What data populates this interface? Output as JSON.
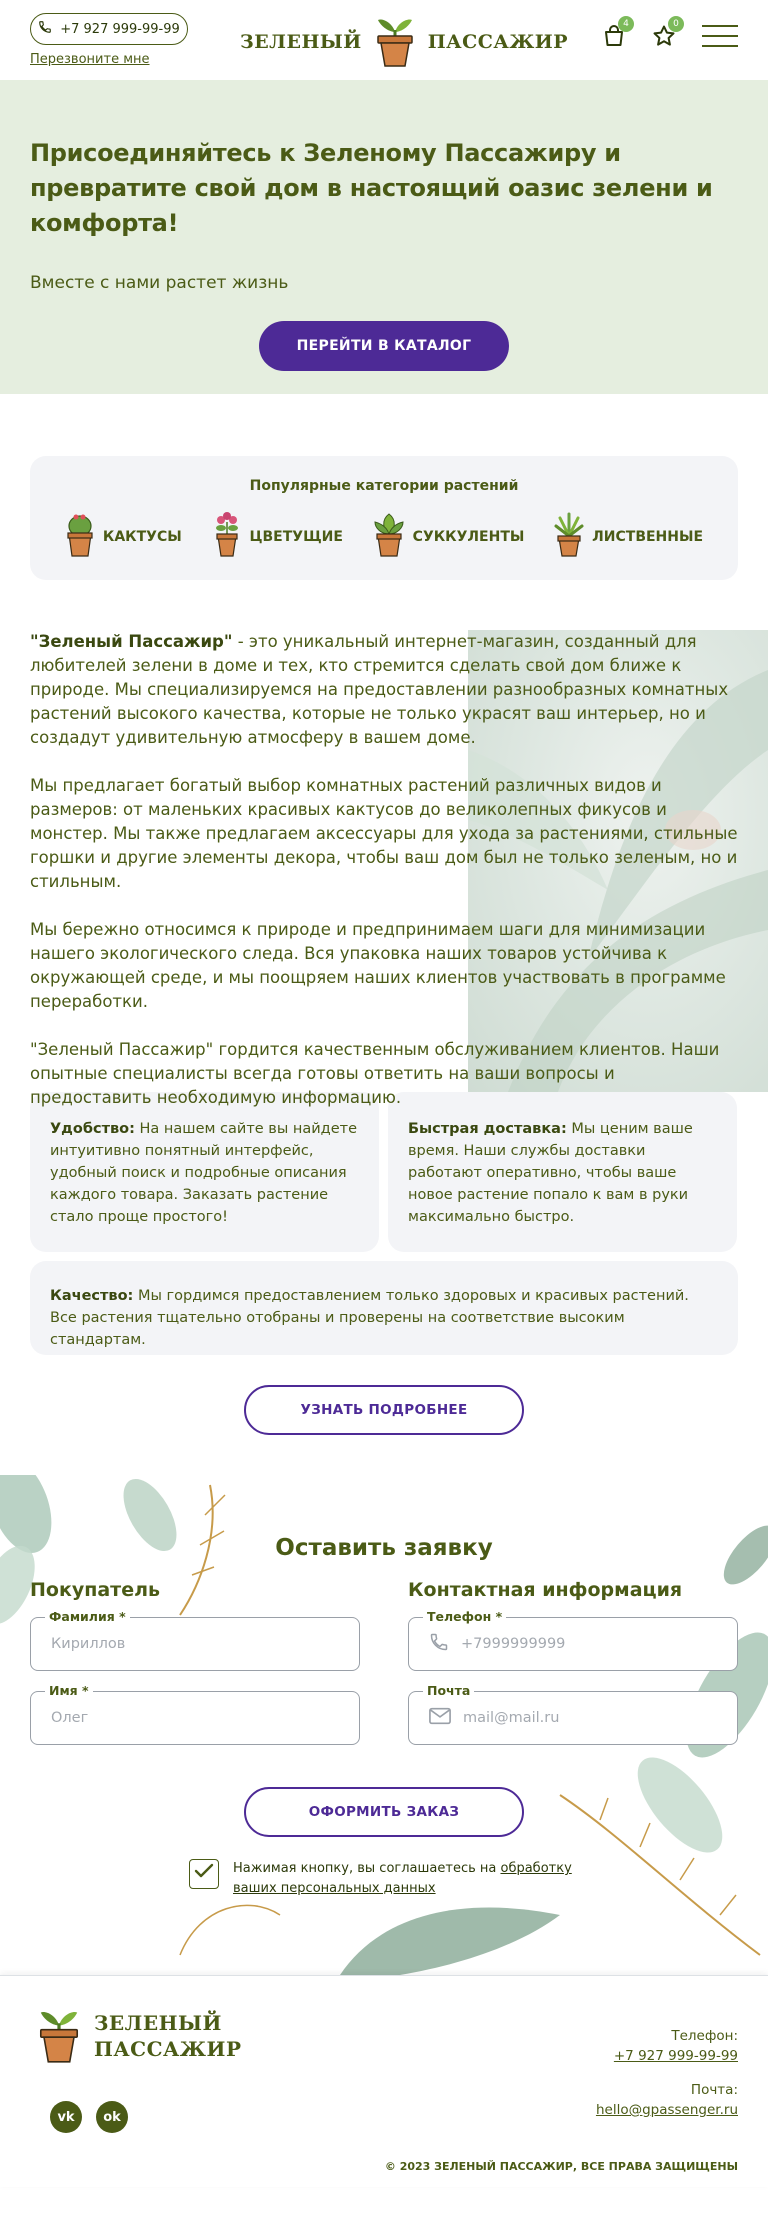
{
  "header": {
    "phone": "+7 927 999-99-99",
    "callback_link": "Перезвоните мне",
    "logo_left": "ЗЕЛЕНЫЙ",
    "logo_right": "ПАССАЖИР",
    "cart_count": "4",
    "favorites_count": "0"
  },
  "hero": {
    "title": "Присоединяйтесь к Зеленому Пассажиру и превратите свой дом в настоящий оазис зелени и комфорта!",
    "subtitle": "Вместе с нами растет жизнь",
    "button": "ПЕРЕЙТИ В КАТАЛОГ"
  },
  "categories": {
    "title": "Популярные категории растений",
    "items": [
      {
        "label": "КАКТУСЫ",
        "icon": "cactus-icon"
      },
      {
        "label": "ЦВЕТУЩИЕ",
        "icon": "flowering-plant-icon"
      },
      {
        "label": "СУККУЛЕНТЫ",
        "icon": "succulent-icon"
      },
      {
        "label": "ЛИСТВЕННЫЕ",
        "icon": "leafy-plant-icon"
      }
    ]
  },
  "about": {
    "p1_strong": "\"Зеленый Пассажир\"",
    "p1": " - это уникальный интернет-магазин, созданный для любителей зелени в доме и тех, кто стремится сделать свой дом ближе к природе. Мы специализируемся на предоставлении разнообразных комнатных растений высокого качества, которые не только украсят ваш интерьер, но и создадут удивительную атмосферу в вашем доме.",
    "p2": "Мы предлагает богатый выбор комнатных растений различных видов и размеров: от маленьких красивых кактусов до великолепных фикусов и монстер. Мы также предлагаем аксессуары для ухода за растениями, стильные горшки и другие элементы декора, чтобы ваш дом был не только зеленым, но и стильным.",
    "p3": "Мы бережно относимся к природе и предпринимаем шаги для минимизации нашего экологического следа. Вся упаковка наших товаров устойчива к окружающей среде, и мы поощряем наших клиентов участвовать в программе переработки.",
    "p4": "\"Зеленый Пассажир\" гордится качественным обслуживанием клиентов. Наши опытные специалисты всегда готовы ответить на ваши вопросы и предоставить необходимую информацию."
  },
  "features": {
    "convenience_title": "Удобство:",
    "convenience_text": " На нашем сайте вы найдете интуитивно понятный интерфейс, удобный поиск и подробные описания каждого товара. Заказать растение стало проще простого!",
    "delivery_title": "Быстрая доставка:",
    "delivery_text": " Мы ценим ваше время. Наши службы доставки работают оперативно, чтобы ваше новое растение попало к вам в руки максимально быстро.",
    "quality_title": "Качество:",
    "quality_text": " Мы гордимся предоставлением только здоровых и красивых растений. Все растения тщательно отобраны и проверены на соответствие высоким стандартам.",
    "more_button": "УЗНАТЬ ПОДРОБНЕЕ"
  },
  "order": {
    "title": "Оставить заявку",
    "buyer_heading": "Покупатель",
    "contact_heading": "Контактная информация",
    "surname_label": "Фамилия *",
    "surname_placeholder": "Кириллов",
    "name_label": "Имя *",
    "name_placeholder": "Олег",
    "phone_label": "Телефон *",
    "phone_placeholder": "+7999999999",
    "email_label": "Почта",
    "email_placeholder": "mail@mail.ru",
    "submit": "ОФОРМИТЬ ЗАКАЗ",
    "consent_text": "Нажимая кнопку, вы соглашаетесь на ",
    "consent_link": "обработку ваших персональных данных"
  },
  "footer": {
    "logo_line1": "ЗЕЛЕНЫЙ",
    "logo_line2": "ПАССАЖИР",
    "phone_label": "Телефон:",
    "phone": "+7 927 999-99-99",
    "email_label": "Почта:",
    "email": "hello@gpassenger.ru",
    "copyright": "© 2023 ЗЕЛЕНЫЙ ПАССАЖИР, ВСЕ ПРАВА ЗАЩИЩЕНЫ",
    "vk": "vk",
    "ok": "ok"
  },
  "colors": {
    "brand_green": "#4b5b16",
    "accent_purple": "#4d2a96",
    "hero_bg": "#e5eedf",
    "card_bg": "#f3f4f7",
    "badge_green": "#7cba5a"
  }
}
